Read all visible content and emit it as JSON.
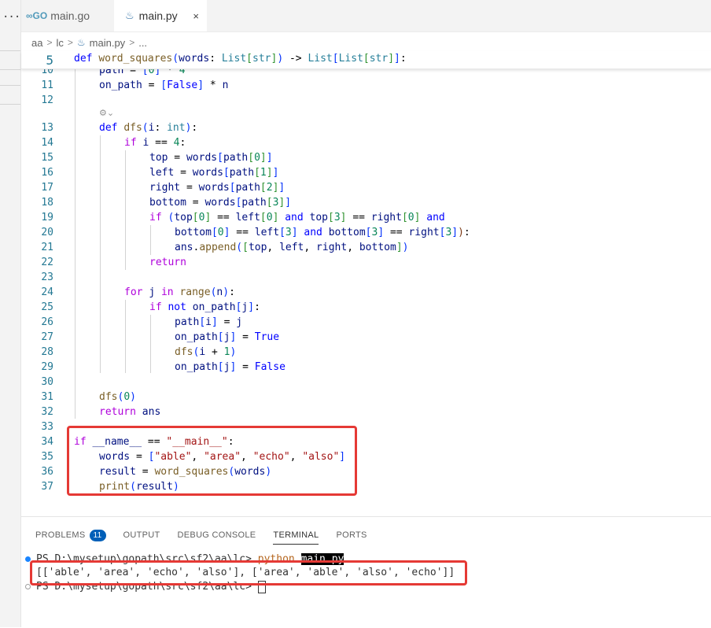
{
  "tabs": [
    {
      "label": "main.go",
      "icon": "go-file-icon"
    },
    {
      "label": "main.py",
      "icon": "python-file-icon",
      "close": "×"
    }
  ],
  "breadcrumb": [
    "aa",
    "lc",
    "main.py",
    "..."
  ],
  "sticky": {
    "line": "5",
    "text": "def word_squares(words: List[str]) -> List[List[str]]:"
  },
  "code_lines": [
    {
      "n": "10",
      "text": "path = [0] * 4"
    },
    {
      "n": "11",
      "text": "on_path = [False] * n"
    },
    {
      "n": "12",
      "text": ""
    },
    {
      "n": "13",
      "text": "def dfs(i: int):"
    },
    {
      "n": "14",
      "text": "if i == 4:"
    },
    {
      "n": "15",
      "text": "top = words[path[0]]"
    },
    {
      "n": "16",
      "text": "left = words[path[1]]"
    },
    {
      "n": "17",
      "text": "right = words[path[2]]"
    },
    {
      "n": "18",
      "text": "bottom = words[path[3]]"
    },
    {
      "n": "19",
      "text": "if (top[0] == left[0] and top[3] == right[0] and"
    },
    {
      "n": "20",
      "text": "bottom[0] == left[3] and bottom[3] == right[3]):"
    },
    {
      "n": "21",
      "text": "ans.append([top, left, right, bottom])"
    },
    {
      "n": "22",
      "text": "return"
    },
    {
      "n": "23",
      "text": ""
    },
    {
      "n": "24",
      "text": "for j in range(n):"
    },
    {
      "n": "25",
      "text": "if not on_path[j]:"
    },
    {
      "n": "26",
      "text": "path[i] = j"
    },
    {
      "n": "27",
      "text": "on_path[j] = True"
    },
    {
      "n": "28",
      "text": "dfs(i + 1)"
    },
    {
      "n": "29",
      "text": "on_path[j] = False"
    },
    {
      "n": "30",
      "text": ""
    },
    {
      "n": "31",
      "text": "dfs(0)"
    },
    {
      "n": "32",
      "text": "return ans"
    },
    {
      "n": "33",
      "text": ""
    },
    {
      "n": "34",
      "text": "if __name__ == \"__main__\":"
    },
    {
      "n": "35",
      "text": "words = [\"able\", \"area\", \"echo\", \"also\"]"
    },
    {
      "n": "36",
      "text": "result = word_squares(words)"
    },
    {
      "n": "37",
      "text": "print(result)"
    }
  ],
  "panel": {
    "tabs": [
      "PROBLEMS",
      "OUTPUT",
      "DEBUG CONSOLE",
      "TERMINAL",
      "PORTS"
    ],
    "active_tab": "TERMINAL",
    "problems_badge": "11"
  },
  "terminal": {
    "prompt1": "PS D:\\mysetup\\gopath\\src\\sf2\\aa\\lc> ",
    "command": "python ",
    "command_selected": "main.py",
    "output": "[['able', 'area', 'echo', 'also'], ['area', 'able', 'also', 'echo']]",
    "prompt2": "PS D:\\mysetup\\gopath\\src\\sf2\\aa\\lc> "
  },
  "colors": {
    "highlight_box": "#e53935",
    "line_number": "#237893",
    "keyword": "#0000ff",
    "control_keyword": "#af00db",
    "function": "#795e26",
    "type": "#267f99",
    "number": "#098658",
    "string": "#a31515",
    "dot_blue": "#1a85ff"
  }
}
